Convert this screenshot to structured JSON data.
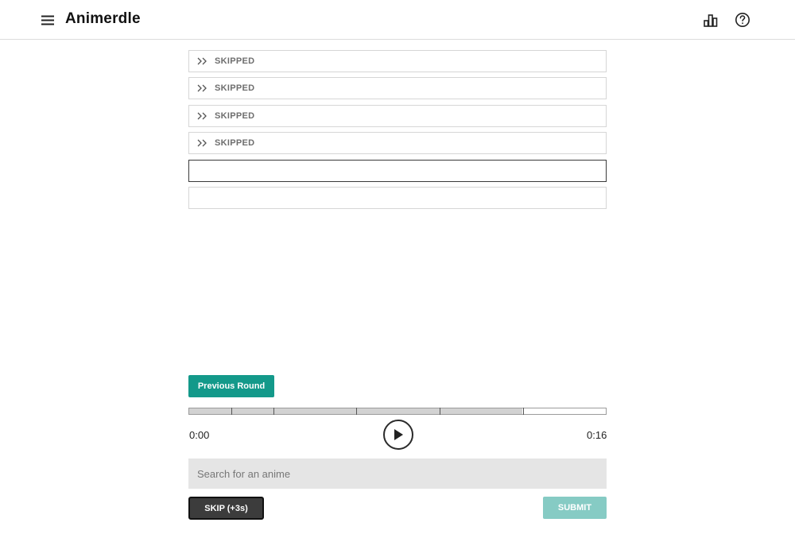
{
  "header": {
    "title": "Animerdle",
    "menu_icon": "hamburger-menu-icon",
    "stats_icon": "bar-chart-icon",
    "help_icon": "question-circle-icon"
  },
  "guesses": [
    {
      "status": "skipped",
      "label": "SKIPPED"
    },
    {
      "status": "skipped",
      "label": "SKIPPED"
    },
    {
      "status": "skipped",
      "label": "SKIPPED"
    },
    {
      "status": "skipped",
      "label": "SKIPPED"
    },
    {
      "status": "current",
      "label": ""
    },
    {
      "status": "empty",
      "label": ""
    }
  ],
  "player": {
    "previous_round_label": "Previous Round",
    "time_current": "0:00",
    "time_total": "0:16",
    "unlocked_fraction": 0.8
  },
  "search": {
    "placeholder": "Search for an anime",
    "value": ""
  },
  "actions": {
    "skip_label": "SKIP (+3s)",
    "submit_label": "SUBMIT"
  },
  "colors": {
    "accent": "#13998a",
    "submit_disabled": "#86cbc4",
    "skip_button": "#3c3c3c"
  }
}
